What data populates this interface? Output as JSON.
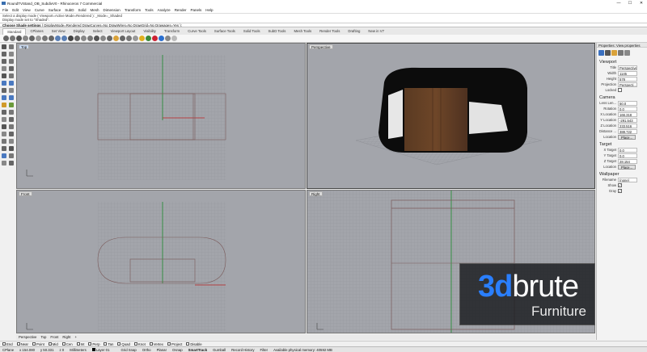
{
  "window": {
    "title": "RoundTVStand_OB_SubdivV0 - Rhinoceros 7 Commercial",
    "minimize": "—",
    "maximize": "☐",
    "close": "✕"
  },
  "menu": [
    "File",
    "Edit",
    "View",
    "Curve",
    "Surface",
    "SubD",
    "Solid",
    "Mesh",
    "Dimension",
    "Transform",
    "Tools",
    "Analyze",
    "Render",
    "Panels",
    "Help"
  ],
  "command_history": [
    "Select a display mode ( Viewport=Active  Mode=Rendered ): _Mode=_Shaded",
    "Display mode set to \"Shaded\"."
  ],
  "command_prompt": {
    "label": "Choose Shade settings",
    "options": "( DisplayMode=Rendered  DrawCurves=No  DrawWires=No  DrawGrid=No  Drawages=Yes ):"
  },
  "toolbar_tabs": [
    "Standard",
    "CPlanes",
    "Set View",
    "Display",
    "Select",
    "Viewport Layout",
    "Visibility",
    "Transform",
    "Curve Tools",
    "Surface Tools",
    "Solid Tools",
    "SubD Tools",
    "Mesh Tools",
    "Render Tools",
    "Drafting",
    "New in V7"
  ],
  "toolbar_active_tab": "Standard",
  "viewports": {
    "top": "Top",
    "perspective": "Perspective",
    "front": "Front",
    "right": "Right"
  },
  "viewport_tabs": [
    "Perspective",
    "Top",
    "Front",
    "Right",
    "+"
  ],
  "properties": {
    "header": "Properties: View properties",
    "viewport_section": "Viewport",
    "viewport": [
      {
        "label": "Title",
        "value": "Perspective",
        "kind": "text"
      },
      {
        "label": "Width",
        "value": "1145",
        "kind": "text"
      },
      {
        "label": "Height",
        "value": "578",
        "kind": "text"
      },
      {
        "label": "Projection",
        "value": "Perspecti...",
        "kind": "text"
      },
      {
        "label": "Locked",
        "value": "",
        "kind": "checkbox"
      }
    ],
    "camera_section": "Camera",
    "camera": [
      {
        "label": "Lens Len...",
        "value": "50.0",
        "kind": "text"
      },
      {
        "label": "Rotation",
        "value": "0.0",
        "kind": "text"
      },
      {
        "label": "X Location",
        "value": "166.318",
        "kind": "text"
      },
      {
        "label": "Y Location",
        "value": "-291.543",
        "kind": "text"
      },
      {
        "label": "Z Location",
        "value": "233.516",
        "kind": "text"
      },
      {
        "label": "Distance ...",
        "value": "388.722",
        "kind": "text"
      },
      {
        "label": "Location",
        "value": "Place...",
        "kind": "button"
      }
    ],
    "target_section": "Target",
    "target": [
      {
        "label": "X Target",
        "value": "0.0",
        "kind": "text"
      },
      {
        "label": "Y Target",
        "value": "0.0",
        "kind": "text"
      },
      {
        "label": "Z Target",
        "value": "28.154",
        "kind": "text"
      },
      {
        "label": "Location",
        "value": "Place...",
        "kind": "button"
      }
    ],
    "wallpaper_section": "Wallpaper",
    "wallpaper": [
      {
        "label": "Filename",
        "value": "(none)",
        "kind": "text"
      },
      {
        "label": "Show",
        "value": "✓",
        "kind": "checkbox"
      },
      {
        "label": "Gray",
        "value": "✓",
        "kind": "checkbox"
      }
    ]
  },
  "osnap": [
    "End",
    "Near",
    "Point",
    "Mid",
    "Cen",
    "Int",
    "Perp",
    "Tan",
    "Quad",
    "Knot",
    "Vertex",
    "Project",
    "Disable"
  ],
  "status": {
    "cplane": "CPlane",
    "x": "x 154.080",
    "y": "y 50.331",
    "z": "z 0",
    "units": "Millimeters",
    "layer": "Layer 01",
    "grid_snap": "Grid Snap",
    "ortho": "Ortho",
    "planar": "Planar",
    "osnap": "Osnap",
    "smarttrack": "SmartTrack",
    "gumball": "Gumball",
    "record_history": "Record History",
    "filter": "Filter",
    "memory": "Available physical memory: 40592 MB"
  },
  "watermark": {
    "brand_num": "3d",
    "brand_word": "brute",
    "tagline": "Furniture"
  }
}
